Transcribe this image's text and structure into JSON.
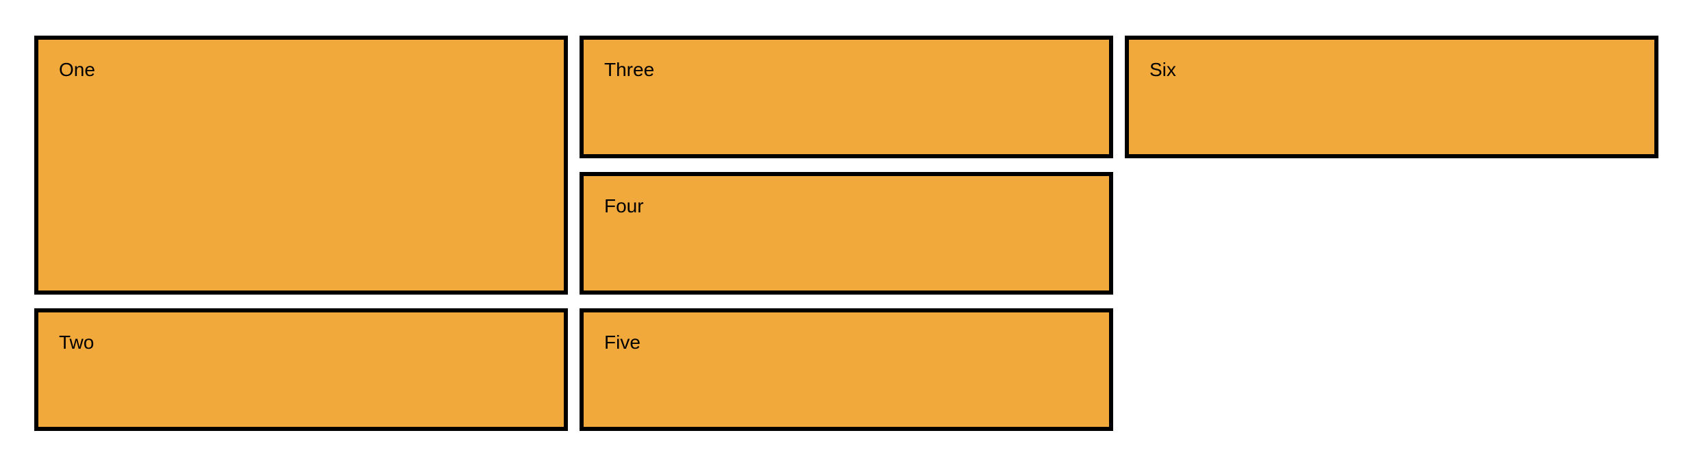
{
  "colors": {
    "box_fill": "#f2a93b",
    "box_border": "#000000",
    "background": "#ffffff"
  },
  "boxes": [
    {
      "label": "One"
    },
    {
      "label": "Two"
    },
    {
      "label": "Three"
    },
    {
      "label": "Four"
    },
    {
      "label": "Five"
    },
    {
      "label": "Six"
    }
  ]
}
